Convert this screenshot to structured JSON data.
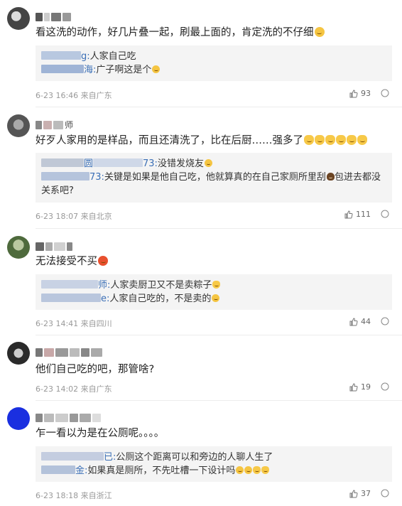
{
  "comments": [
    {
      "text": "看这洗的动作，好几片叠一起，刷最上面的，肯定洗的不仔细",
      "replies": [
        {
          "name_suffix": "g:",
          "text": "人家自己吃"
        },
        {
          "name_suffix": "海:",
          "text": "广子啊这是个"
        }
      ],
      "time": "6-23 16:46",
      "location": "来自广东",
      "likes": "93"
    },
    {
      "name_visible": "师",
      "text": "好歹人家用的是样品，而且还清洗了，比在后厨……强多了",
      "replies": [
        {
          "name_prefix": "圆",
          "name_suffix": "73:",
          "text": "没错发烧友"
        },
        {
          "name_suffix": "73:",
          "text": "关键是如果是他自己吃，他就算真的在自己家厕所里刮",
          "text2": "包进去都没",
          "cont": "关系吧?"
        }
      ],
      "time": "6-23 18:07",
      "location": "来自北京",
      "likes": "111"
    },
    {
      "text": "无法接受不买",
      "replies": [
        {
          "name_suffix": "师:",
          "text": "人家卖厨卫又不是卖粽子"
        },
        {
          "name_suffix": "e:",
          "text": "人家自己吃的，不是卖的"
        }
      ],
      "time": "6-23 14:41",
      "location": "来自四川",
      "likes": "44"
    },
    {
      "text": "他们自己吃的吧，那管啥?",
      "replies": [],
      "time": "6-23 14:02",
      "location": "来自广东",
      "likes": "19"
    },
    {
      "text": "乍一看以为是在公厕呢。。。。",
      "replies": [
        {
          "name_suffix": "已:",
          "text": "公厕这个距离可以和旁边的人聊人生了"
        },
        {
          "name_suffix": "金:",
          "text": "如果真是厕所，不先吐槽一下设计吗"
        }
      ],
      "time": "6-23 18:18",
      "location": "来自浙江",
      "likes": "37"
    }
  ],
  "icons": {
    "like": "thumbs-up-icon",
    "more": "more-circle-icon"
  },
  "colors": {
    "avatar1": "#3a3a3a",
    "avatar2": "#6b6b6b",
    "avatar3": "#5a7a4a",
    "avatar4": "#2a2a2a",
    "avatar5": "#1a2fe0"
  }
}
